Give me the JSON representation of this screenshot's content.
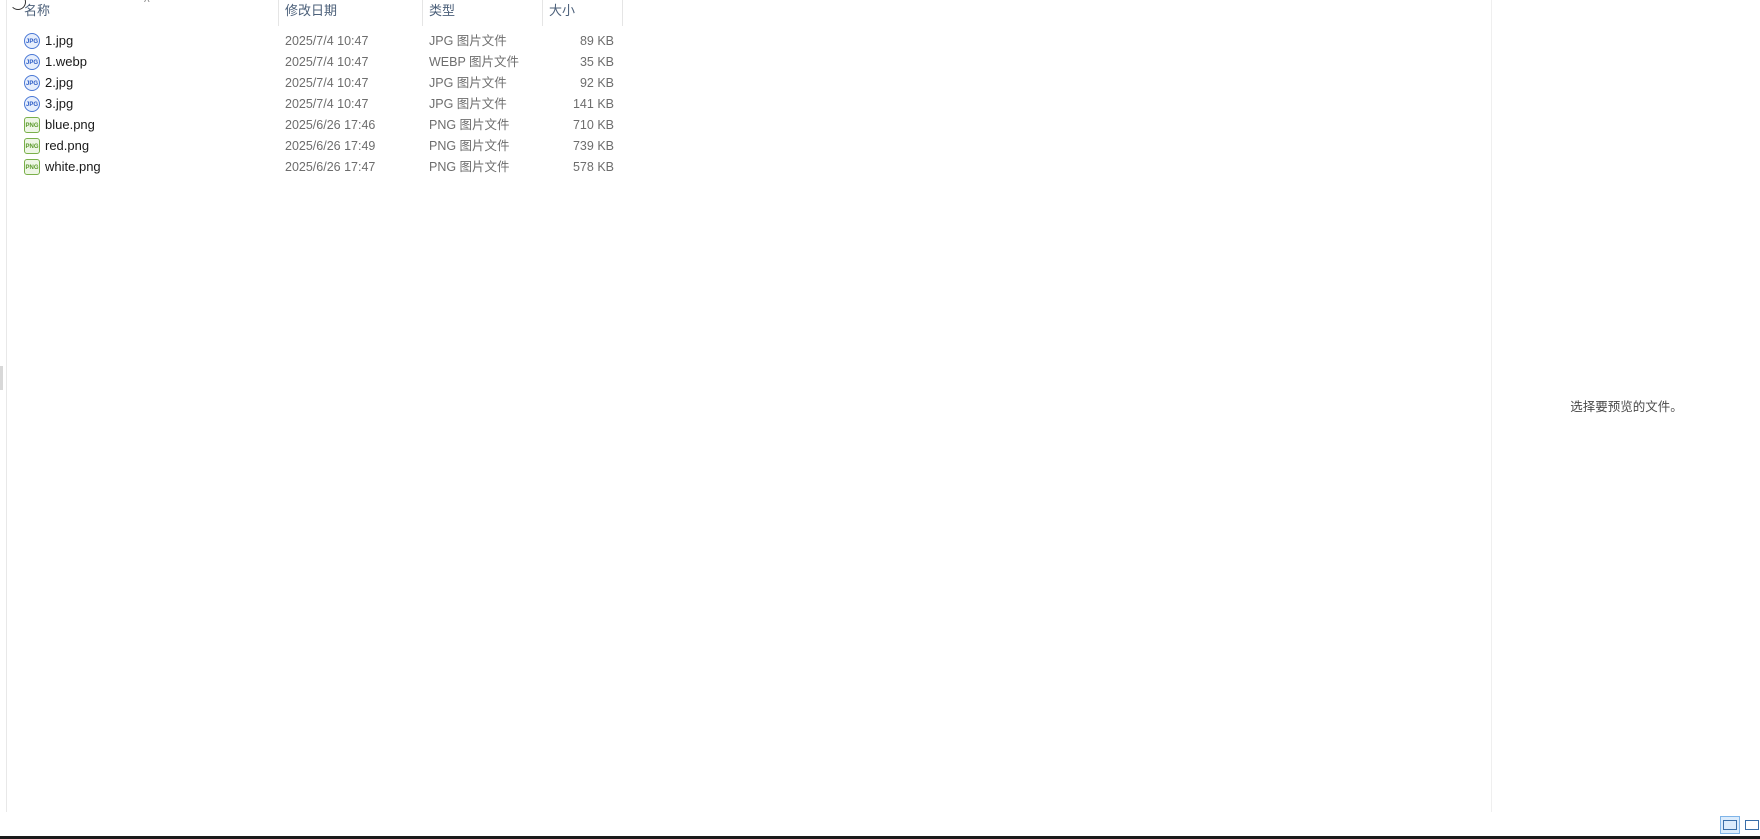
{
  "columns": {
    "name": "名称",
    "date": "修改日期",
    "type": "类型",
    "size": "大小"
  },
  "files": [
    {
      "name": "1.jpg",
      "date": "2025/7/4 10:47",
      "type": "JPG 图片文件",
      "size": "89 KB",
      "icon": "jpg-file-icon"
    },
    {
      "name": "1.webp",
      "date": "2025/7/4 10:47",
      "type": "WEBP 图片文件",
      "size": "35 KB",
      "icon": "jpg-file-icon"
    },
    {
      "name": "2.jpg",
      "date": "2025/7/4 10:47",
      "type": "JPG 图片文件",
      "size": "92 KB",
      "icon": "jpg-file-icon"
    },
    {
      "name": "3.jpg",
      "date": "2025/7/4 10:47",
      "type": "JPG 图片文件",
      "size": "141 KB",
      "icon": "jpg-file-icon"
    },
    {
      "name": "blue.png",
      "date": "2025/6/26 17:46",
      "type": "PNG 图片文件",
      "size": "710 KB",
      "icon": "png-file-icon"
    },
    {
      "name": "red.png",
      "date": "2025/6/26 17:49",
      "type": "PNG 图片文件",
      "size": "739 KB",
      "icon": "png-file-icon"
    },
    {
      "name": "white.png",
      "date": "2025/6/26 17:47",
      "type": "PNG 图片文件",
      "size": "578 KB",
      "icon": "png-file-icon"
    }
  ],
  "preview": {
    "message": "选择要预览的文件。"
  },
  "view_buttons": {
    "details_icon": "details-view-icon",
    "large_icon": "large-icons-view-icon"
  },
  "colors": {
    "header_text": "#4c607a",
    "selected_view": "#dcecfc",
    "muted_text": "#6d6d6d"
  }
}
